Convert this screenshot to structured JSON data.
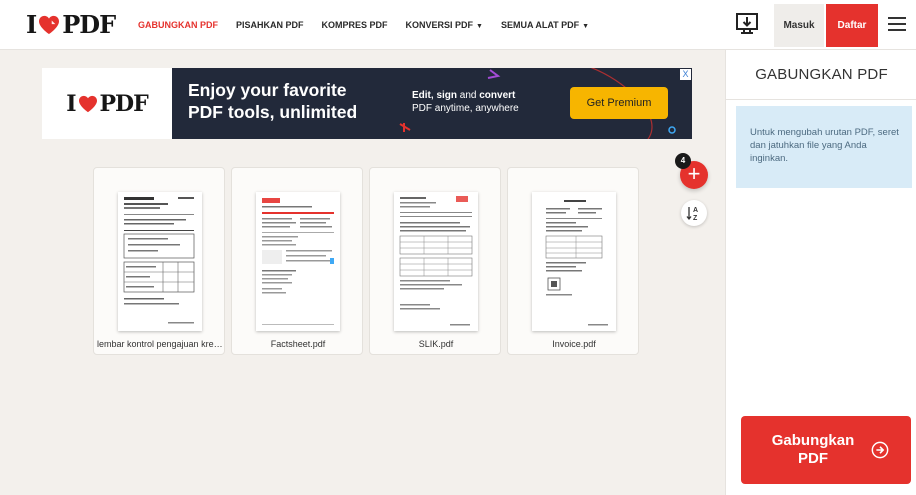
{
  "brand": {
    "logo_left": "I",
    "logo_right": "PDF",
    "accent": "#e5322d"
  },
  "nav": {
    "items": [
      {
        "label": "GABUNGKAN PDF",
        "active": true
      },
      {
        "label": "PISAHKAN PDF",
        "active": false
      },
      {
        "label": "KOMPRES PDF",
        "active": false
      },
      {
        "label": "KONVERSI PDF",
        "active": false,
        "dropdown": true
      },
      {
        "label": "SEMUA ALAT PDF",
        "active": false,
        "dropdown": true
      }
    ],
    "caret": "▼"
  },
  "header": {
    "login_label": "Masuk",
    "signup_label": "Daftar",
    "desktop_icon": "desktop-download-icon",
    "menu_icon": "hamburger-menu-icon"
  },
  "ad": {
    "logo_left": "I",
    "logo_right": "PDF",
    "headline": "Enjoy your favorite PDF tools, unlimited",
    "sub_bold_1": "Edit, sign",
    "sub_mid": " and ",
    "sub_bold_2": "convert",
    "sub_rest": "PDF anytime, anywhere",
    "cta": "Get Premium",
    "close": "X",
    "cta_color": "#f7b500",
    "bg_color": "#22293a"
  },
  "files": [
    {
      "name": "lembar kontrol pengajuan kred..."
    },
    {
      "name": "Factsheet.pdf"
    },
    {
      "name": "SLIK.pdf"
    },
    {
      "name": "Invoice.pdf"
    }
  ],
  "add_files": {
    "count": "4",
    "symbol": "+"
  },
  "sort": {
    "icon": "sort-az-icon"
  },
  "sidebar": {
    "title": "GABUNGKAN PDF",
    "info": "Untuk mengubah urutan PDF, seret dan jatuhkan file yang Anda inginkan.",
    "merge_label": "Gabungkan PDF"
  }
}
